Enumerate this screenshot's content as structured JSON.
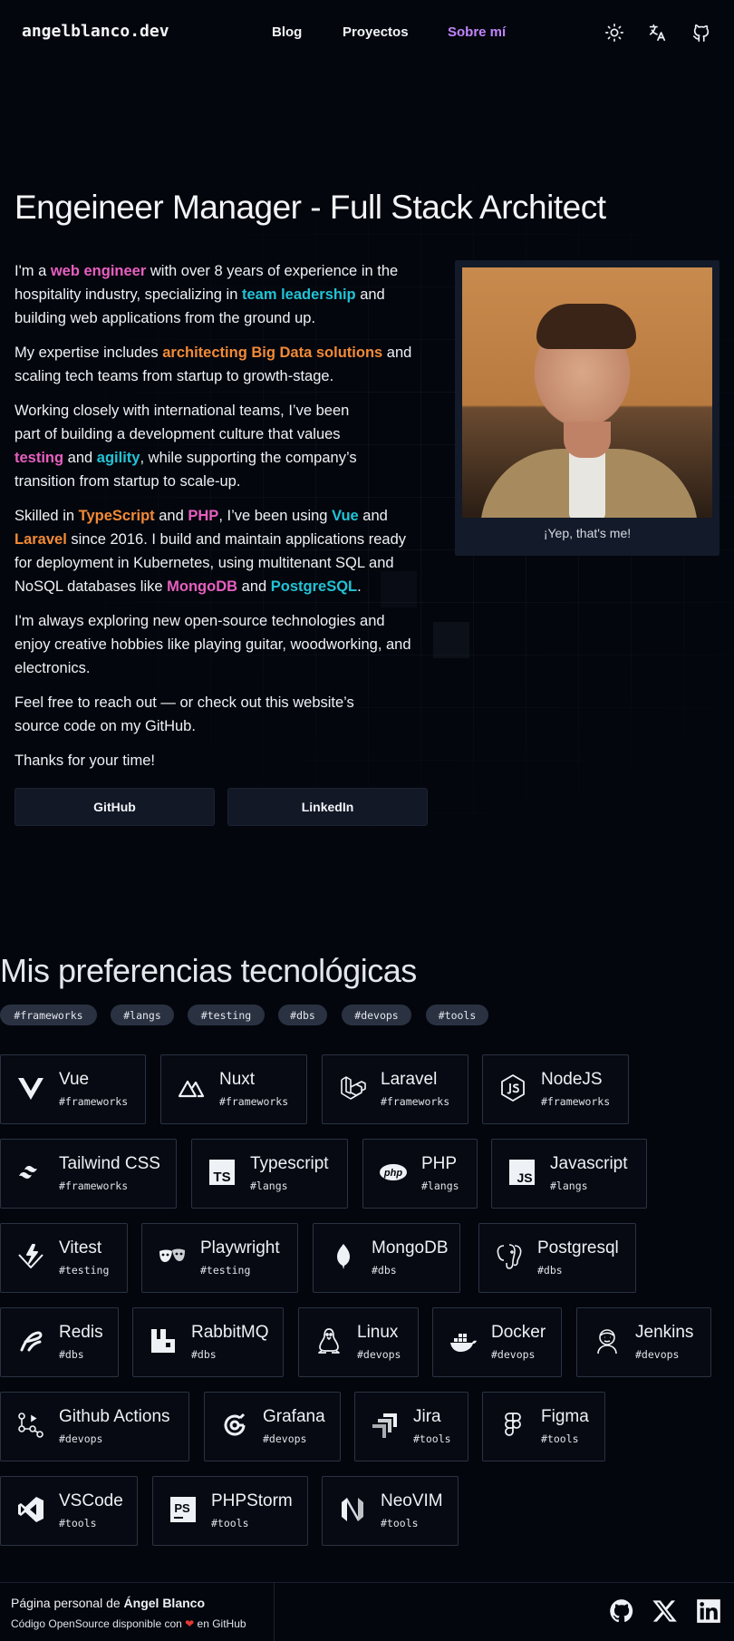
{
  "nav": {
    "brand": "angelblanco.dev",
    "links": [
      {
        "label": "Blog",
        "active": false
      },
      {
        "label": "Proyectos",
        "active": false
      },
      {
        "label": "Sobre mí",
        "active": true
      }
    ],
    "icons": [
      "sun-icon",
      "translate-icon",
      "github-icon"
    ]
  },
  "hero": {
    "title": "Engeineer Manager - Full Stack Architect",
    "paragraphs": [
      [
        "I'm a ",
        "web engineer",
        " with over 8 years of experience in the hospitality industry, specializing in ",
        "team leadership",
        " and building web applications from the ground up."
      ],
      [
        "My expertise includes ",
        "architecting Big Data solutions",
        " and scaling tech teams from startup to growth-stage."
      ],
      [
        "Working closely with international teams, I’ve been part of building a development culture that values ",
        "testing",
        " and ",
        "agility",
        ", while supporting the company’s transition from startup to scale-up."
      ],
      [
        "Skilled in ",
        "TypeScript",
        " and ",
        "PHP",
        ", I’ve been using ",
        "Vue",
        " and ",
        "Laravel",
        " since 2016. I build and maintain applications ready for deployment in Kubernetes, using multitenant SQL and NoSQL databases like ",
        "MongoDB",
        " and ",
        "PostgreSQL",
        "."
      ],
      [
        "I'm always exploring new open-source technologies and enjoy creative hobbies like playing guitar, woodworking, and electronics."
      ],
      [
        "Feel free to reach out — or check out this website’s source code on my GitHub."
      ],
      [
        "Thanks for your time!"
      ]
    ],
    "buttons": {
      "github": "GitHub",
      "linkedin": "LinkedIn"
    },
    "photo_caption": "¡Yep, that's me!"
  },
  "tech": {
    "title": "Mis preferencias tecnológicas",
    "tags": [
      "#frameworks",
      "#langs",
      "#testing",
      "#dbs",
      "#devops",
      "#tools"
    ],
    "items": [
      {
        "name": "Vue",
        "category": "#frameworks",
        "icon": "vue-icon"
      },
      {
        "name": "Nuxt",
        "category": "#frameworks",
        "icon": "nuxt-icon"
      },
      {
        "name": "Laravel",
        "category": "#frameworks",
        "icon": "laravel-icon"
      },
      {
        "name": "NodeJS",
        "category": "#frameworks",
        "icon": "nodejs-icon"
      },
      {
        "name": "Tailwind CSS",
        "category": "#frameworks",
        "icon": "tailwind-icon"
      },
      {
        "name": "Typescript",
        "category": "#langs",
        "icon": "typescript-icon"
      },
      {
        "name": "PHP",
        "category": "#langs",
        "icon": "php-icon"
      },
      {
        "name": "Javascript",
        "category": "#langs",
        "icon": "javascript-icon"
      },
      {
        "name": "Vitest",
        "category": "#testing",
        "icon": "vitest-icon"
      },
      {
        "name": "Playwright",
        "category": "#testing",
        "icon": "playwright-icon"
      },
      {
        "name": "MongoDB",
        "category": "#dbs",
        "icon": "mongodb-icon"
      },
      {
        "name": "Postgresql",
        "category": "#dbs",
        "icon": "postgresql-icon"
      },
      {
        "name": "Redis",
        "category": "#dbs",
        "icon": "redis-icon"
      },
      {
        "name": "RabbitMQ",
        "category": "#dbs",
        "icon": "rabbitmq-icon"
      },
      {
        "name": "Linux",
        "category": "#devops",
        "icon": "linux-icon"
      },
      {
        "name": "Docker",
        "category": "#devops",
        "icon": "docker-icon"
      },
      {
        "name": "Jenkins",
        "category": "#devops",
        "icon": "jenkins-icon"
      },
      {
        "name": "Github Actions",
        "category": "#devops",
        "icon": "github-actions-icon"
      },
      {
        "name": "Grafana",
        "category": "#devops",
        "icon": "grafana-icon"
      },
      {
        "name": "Jira",
        "category": "#tools",
        "icon": "jira-icon"
      },
      {
        "name": "Figma",
        "category": "#tools",
        "icon": "figma-icon"
      },
      {
        "name": "VSCode",
        "category": "#tools",
        "icon": "vscode-icon"
      },
      {
        "name": "PHPStorm",
        "category": "#tools",
        "icon": "phpstorm-icon"
      },
      {
        "name": "NeoVIM",
        "category": "#tools",
        "icon": "neovim-icon"
      }
    ]
  },
  "footer": {
    "line1_prefix": "Página personal de ",
    "line1_name": "Ángel Blanco",
    "line2_prefix": "Código OpenSource disponible con ",
    "line2_suffix": " en GitHub",
    "icons": [
      "github-icon",
      "x-icon",
      "linkedin-icon"
    ]
  },
  "colors": {
    "accent_purple": "#c084fc",
    "pink": "#e75fc0",
    "cyan": "#22c3d6",
    "orange": "#f28a36",
    "background": "#04060d"
  }
}
